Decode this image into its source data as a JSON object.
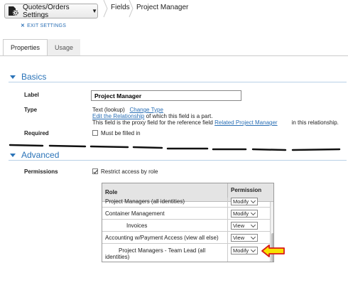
{
  "header": {
    "settings_button": "Quotes/Orders Settings",
    "breadcrumb_fields": "Fields",
    "breadcrumb_current": "Project Manager",
    "exit_link": "EXIT SETTINGS"
  },
  "tabs": [
    {
      "label": "Properties",
      "active": true
    },
    {
      "label": "Usage",
      "active": false
    }
  ],
  "basics": {
    "title": "Basics",
    "label_caption": "Label",
    "label_value": "Project Manager",
    "type_caption": "Type",
    "type_value": "Text (lookup)",
    "change_type_link": "Change Type",
    "edit_relationship_link": "Edit the Relationship",
    "edit_relationship_suffix": " of which this field is a part.",
    "proxy_prefix": "This field is the proxy field for the reference field ",
    "proxy_link": "Related Project Manager",
    "proxy_suffix": "in this relationship.",
    "required_caption": "Required",
    "required_checkbox_label": "Must be filled in",
    "required_checked": false
  },
  "advanced": {
    "title": "Advanced",
    "permissions_caption": "Permissions",
    "restrict_label": "Restrict access by role",
    "restrict_checked": true,
    "table": {
      "col_role": "Role",
      "col_permission": "Permission",
      "rows": [
        {
          "role": "Project Managers (all identities)",
          "permission": "Modify"
        },
        {
          "role": "Container Management",
          "permission": "Modify"
        },
        {
          "role": "Invoices",
          "permission": "View"
        },
        {
          "role": "Accounting w/Payment Access (view all else)",
          "permission": "View"
        },
        {
          "role": "Project Managers - Team Lead (all identities)",
          "permission": "Modify"
        }
      ]
    }
  },
  "colors": {
    "accent": "#2a73b8",
    "link": "#2a6fb5",
    "arrow_fill": "#f7e200",
    "arrow_stroke": "#d91a1a"
  }
}
